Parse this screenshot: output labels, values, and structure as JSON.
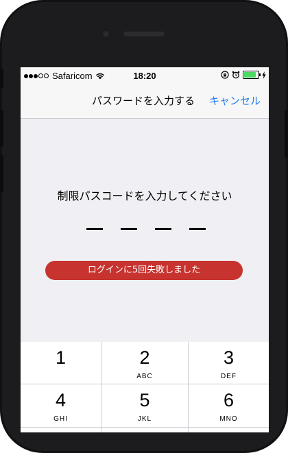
{
  "status_bar": {
    "carrier": "Safaricom",
    "time": "18:20"
  },
  "navbar": {
    "title": "パスワードを入力する",
    "cancel_label": "キャンセル"
  },
  "passcode": {
    "prompt": "制限パスコードを入力してください",
    "slot_count": 4,
    "error_message": "ログインに5回失敗しました"
  },
  "keypad": {
    "keys": [
      {
        "digit": "1",
        "letters": ""
      },
      {
        "digit": "2",
        "letters": "ABC"
      },
      {
        "digit": "3",
        "letters": "DEF"
      },
      {
        "digit": "4",
        "letters": "GHI"
      },
      {
        "digit": "5",
        "letters": "JKL"
      },
      {
        "digit": "6",
        "letters": "MNO"
      }
    ]
  },
  "colors": {
    "accent": "#1f7df0",
    "error": "#c7332e",
    "battery": "#4cd964"
  }
}
